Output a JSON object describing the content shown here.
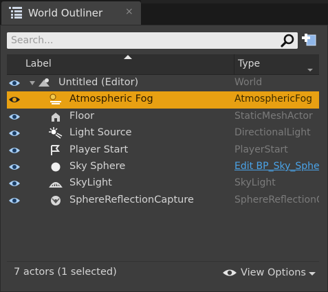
{
  "tab": {
    "title": "World Outliner",
    "close": "×",
    "icon": "outliner-list-icon"
  },
  "search": {
    "placeholder": "Search...",
    "value": ""
  },
  "columns": {
    "label": "Label",
    "type": "Type"
  },
  "rows": [
    {
      "label": "Untitled (Editor)",
      "type": "World",
      "icon": "world-icon",
      "selected": false,
      "type_link": false
    },
    {
      "label": "Atmospheric Fog",
      "type": "AtmosphericFog",
      "icon": "fog-icon",
      "selected": true,
      "type_link": false
    },
    {
      "label": "Floor",
      "type": "StaticMeshActor",
      "icon": "static-mesh-icon",
      "selected": false,
      "type_link": false
    },
    {
      "label": "Light Source",
      "type": "DirectionalLight",
      "icon": "directional-light-icon",
      "selected": false,
      "type_link": false
    },
    {
      "label": "Player Start",
      "type": "PlayerStart",
      "icon": "player-start-icon",
      "selected": false,
      "type_link": false
    },
    {
      "label": "Sky Sphere",
      "type": "Edit BP_Sky_Sphere",
      "icon": "sphere-icon",
      "selected": false,
      "type_link": true
    },
    {
      "label": "SkyLight",
      "type": "SkyLight",
      "icon": "skylight-icon",
      "selected": false,
      "type_link": false
    },
    {
      "label": "SphereReflectionCapture",
      "type": "SphereReflectionCapture",
      "icon": "reflection-capture-icon",
      "selected": false,
      "type_link": false
    }
  ],
  "footer": {
    "status": "7 actors (1 selected)",
    "view_options": "View Options"
  },
  "colors": {
    "selection": "#e8a012",
    "link": "#4aa3e8",
    "panel": "#3d3d3d",
    "eye": "#9ec7ef"
  }
}
